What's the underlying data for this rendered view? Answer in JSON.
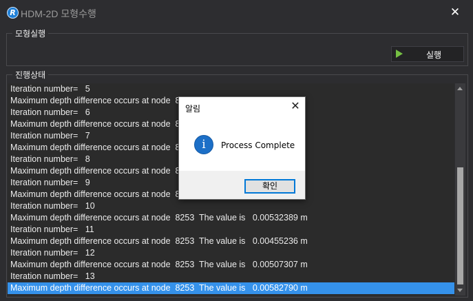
{
  "window": {
    "app_icon_letter": "R",
    "title": "HDM-2D 모형수행",
    "close_glyph": "✕"
  },
  "run_group": {
    "legend": "모형실행",
    "run_button_label": "실행"
  },
  "progress_group": {
    "legend": "진행상태"
  },
  "log": {
    "lines": [
      "Iteration number=   5",
      "Maximum depth difference occurs at node  8",
      "Iteration number=   6",
      "Maximum depth difference occurs at node  8",
      "Iteration number=   7",
      "Maximum depth difference occurs at node  8",
      "Iteration number=   8",
      "Maximum depth difference occurs at node  8",
      "Iteration number=   9",
      "Maximum depth difference occurs at node  8",
      "Iteration number=   10",
      "Maximum depth difference occurs at node  8253  The value is   0.00532389 m",
      "Iteration number=   11",
      "Maximum depth difference occurs at node  8253  The value is   0.00455236 m",
      "Iteration number=   12",
      "Maximum depth difference occurs at node  8253  The value is   0.00507307 m",
      "Iteration number=   13",
      "Maximum depth difference occurs at node  8253  The value is   0.00582790 m"
    ],
    "selected_index": 17
  },
  "dialog": {
    "title": "알림",
    "close_glyph": "✕",
    "icon_glyph": "i",
    "message": "Process Complete",
    "ok_label": "확인"
  },
  "colors": {
    "background": "#2d2d30",
    "selection": "#3591ea",
    "dialog_focus": "#0078d7",
    "run_icon": "#76c043"
  }
}
